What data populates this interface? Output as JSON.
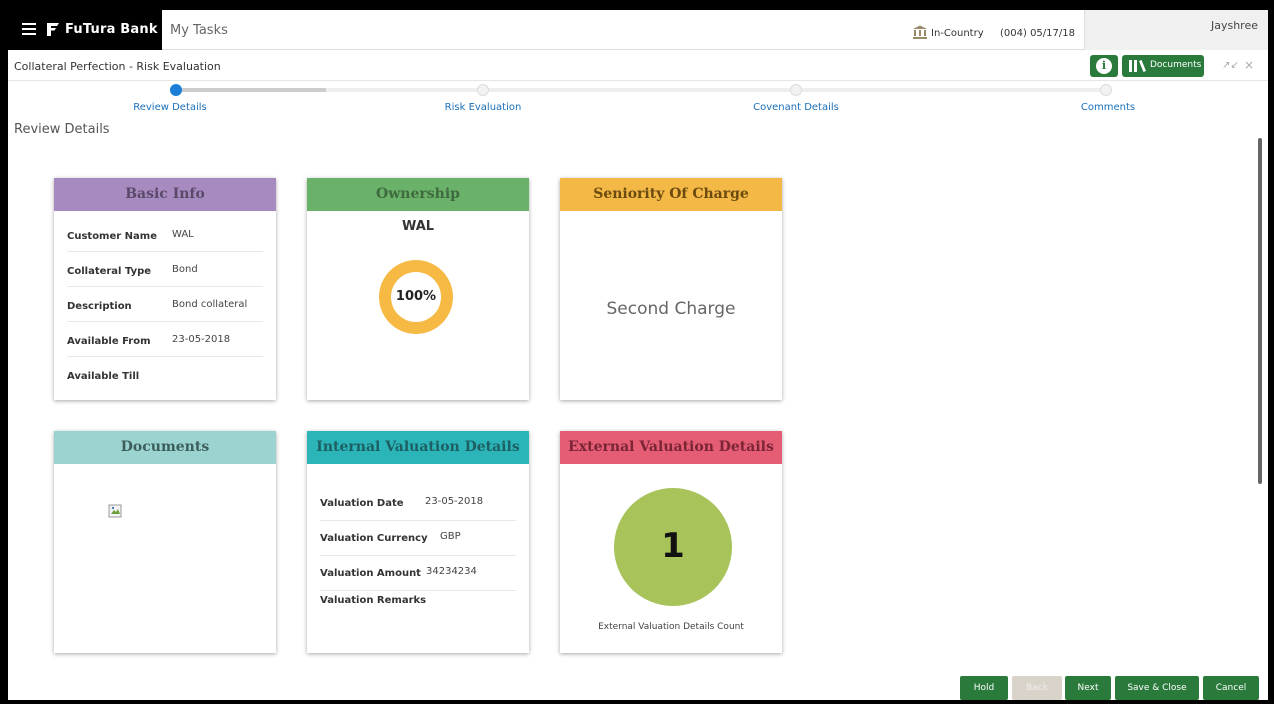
{
  "header": {
    "brand": "FuTura Bank",
    "my_tasks": "My Tasks",
    "branch": "In-Country",
    "branch_date": "(004)  05/17/18",
    "user": "Jayshree"
  },
  "titlebar": {
    "title": "Collateral Perfection - Risk Evaluation",
    "documents_label": "Documents",
    "info_icon": "i",
    "minimize_icon": "↗↙",
    "close_icon": "×"
  },
  "steps": [
    {
      "label": "Review Details",
      "active": true
    },
    {
      "label": "Risk Evaluation",
      "active": false
    },
    {
      "label": "Covenant Details",
      "active": false
    },
    {
      "label": "Comments",
      "active": false
    }
  ],
  "section_heading": "Review Details",
  "colors": {
    "basic_info": "#a78abf",
    "ownership": "#6ab26a",
    "seniority": "#f4b846",
    "documents": "#9ad3cf",
    "internal_valuation": "#2bb5b9",
    "external_valuation": "#e45d75",
    "primary_button": "#2a7a3b"
  },
  "basic_info": {
    "title": "Basic Info",
    "rows": [
      {
        "key": "Customer Name",
        "value": "WAL"
      },
      {
        "key": "Collateral Type",
        "value": "Bond"
      },
      {
        "key": "Description",
        "value": "Bond collateral"
      },
      {
        "key": "Available From",
        "value": "23-05-2018"
      },
      {
        "key": "Available Till",
        "value": ""
      }
    ]
  },
  "ownership": {
    "title": "Ownership",
    "owner": "WAL",
    "percentage_label": "100%",
    "percentage": 100
  },
  "seniority": {
    "title": "Seniority Of Charge",
    "value": "Second Charge"
  },
  "documents": {
    "title": "Documents"
  },
  "internal_valuation": {
    "title": "Internal Valuation Details",
    "rows": [
      {
        "key": "Valuation Date",
        "value": "23-05-2018"
      },
      {
        "key": "Valuation Currency",
        "value": "GBP"
      },
      {
        "key": "Valuation Amount",
        "value": "34234234"
      },
      {
        "key": "Valuation Remarks",
        "value": ""
      }
    ]
  },
  "external_valuation": {
    "title": "External Valuation Details",
    "count": "1",
    "caption": "External Valuation Details Count"
  },
  "footer": {
    "hold": "Hold",
    "back": "Back",
    "next": "Next",
    "save_close": "Save & Close",
    "cancel": "Cancel"
  }
}
